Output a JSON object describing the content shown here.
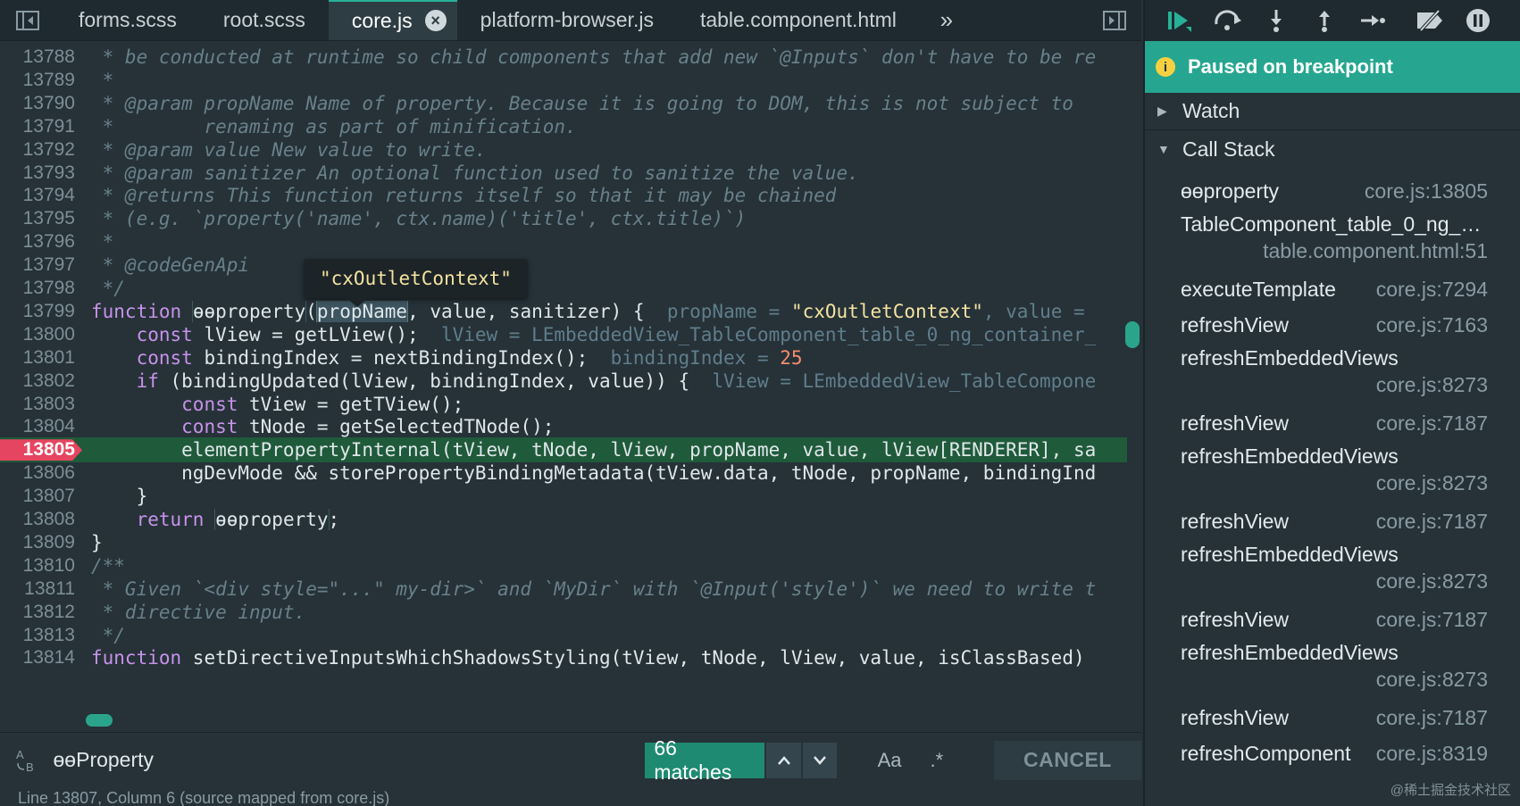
{
  "tabs": [
    "forms.scss",
    "root.scss",
    "core.js",
    "platform-browser.js",
    "table.component.html"
  ],
  "active_tab_index": 2,
  "code_lines": [
    {
      "n": "13788",
      "html": "<span class='cm'> * be conducted at runtime so child components that add new `@Inputs` don't have to be re</span>"
    },
    {
      "n": "13789",
      "html": "<span class='cm'> *</span>"
    },
    {
      "n": "13790",
      "html": "<span class='cm'> * @param propName Name of property. Because it is going to DOM, this is not subject to</span>"
    },
    {
      "n": "13791",
      "html": "<span class='cm'> *        renaming as part of minification.</span>"
    },
    {
      "n": "13792",
      "html": "<span class='cm'> * @param value New value to write.</span>"
    },
    {
      "n": "13793",
      "html": "<span class='cm'> * @param sanitizer An optional function used to sanitize the value.</span>"
    },
    {
      "n": "13794",
      "html": "<span class='cm'> * @returns This function returns itself so that it may be chained</span>"
    },
    {
      "n": "13795",
      "html": "<span class='cm'> * (e.g. `property('name', ctx.name)('title', ctx.title)`)</span>"
    },
    {
      "n": "13796",
      "html": "<span class='cm'> *</span>"
    },
    {
      "n": "13797",
      "html": "<span class='cm'> * @codeGenApi</span>"
    },
    {
      "n": "13798",
      "html": "<span class='cm'> */</span>"
    },
    {
      "n": "13799",
      "html": "<span class='kw'>function</span> <span class='boxed'>ɵɵproperty</span>(<span class='sel'>propName</span>, value, sanitizer) {  <span class='inline-val'>propName = </span><span class='inline-str'>\"cxOutletContext\"</span><span class='inline-val'>, value = </span>"
    },
    {
      "n": "13800",
      "html": "    <span class='kw'>const</span> lView = getLView();  <span class='inline-val'>lView = LEmbeddedView_TableComponent_table_0_ng_container_</span>"
    },
    {
      "n": "13801",
      "html": "    <span class='kw'>const</span> bindingIndex = nextBindingIndex();  <span class='inline-val'>bindingIndex = </span><span class='inline-num'>25</span>"
    },
    {
      "n": "13802",
      "html": "    <span class='kw'>if</span> (bindingUpdated(lView, bindingIndex, value)) {  <span class='inline-val'>lView = LEmbeddedView_TableCompone</span>"
    },
    {
      "n": "13803",
      "html": "        <span class='kw'>const</span> tView = getTView();"
    },
    {
      "n": "13804",
      "html": "        <span class='kw'>const</span> tNode = getSelectedTNode();"
    },
    {
      "n": "13805",
      "html": "        elementPropertyInternal(tView, tNode, lView, propName, value, lView[RENDERER], sa",
      "current": true
    },
    {
      "n": "13806",
      "html": "        ngDevMode &amp;&amp; storePropertyBindingMetadata(tView.data, tNode, propName, bindingInd"
    },
    {
      "n": "13807",
      "html": "    }"
    },
    {
      "n": "13808",
      "html": "    <span class='kw'>return</span> <span class='boxed'>ɵɵproperty</span>;"
    },
    {
      "n": "13809",
      "html": "}"
    },
    {
      "n": "13810",
      "html": "<span class='cm'>/**</span>"
    },
    {
      "n": "13811",
      "html": "<span class='cm'> * Given `&lt;div style=\"...\" my-dir&gt;` and `MyDir` with `@Input('style')` we need to write t</span>"
    },
    {
      "n": "13812",
      "html": "<span class='cm'> * directive input.</span>"
    },
    {
      "n": "13813",
      "html": "<span class='cm'> */</span>"
    },
    {
      "n": "13814",
      "html": "<span class='kw'>function</span> setDirectiveInputsWhichShadowsStyling(tView, tNode, lView, value, isClassBased)"
    }
  ],
  "tooltip": "\"cxOutletContext\"",
  "search": {
    "value": "ɵɵProperty",
    "matches": "66 matches",
    "case_label": "Aa",
    "regex_label": ".*",
    "cancel_label": "CANCEL"
  },
  "status_text": "Line 13807, Column 6    (source mapped from core.js)",
  "debugger": {
    "paused_label": "Paused on breakpoint",
    "watch_label": "Watch",
    "callstack_label": "Call Stack",
    "frames": [
      {
        "name": "ɵɵproperty",
        "loc": "core.js:13805",
        "wrap": false
      },
      {
        "name": "TableComponent_table_0_ng_co...",
        "loc": "table.component.html:51",
        "wrap": true
      },
      {
        "name": "executeTemplate",
        "loc": "core.js:7294",
        "wrap": false
      },
      {
        "name": "refreshView",
        "loc": "core.js:7163",
        "wrap": false
      },
      {
        "name": "refreshEmbeddedViews",
        "loc": "core.js:8273",
        "wrap": true
      },
      {
        "name": "refreshView",
        "loc": "core.js:7187",
        "wrap": false
      },
      {
        "name": "refreshEmbeddedViews",
        "loc": "core.js:8273",
        "wrap": true
      },
      {
        "name": "refreshView",
        "loc": "core.js:7187",
        "wrap": false
      },
      {
        "name": "refreshEmbeddedViews",
        "loc": "core.js:8273",
        "wrap": true
      },
      {
        "name": "refreshView",
        "loc": "core.js:7187",
        "wrap": false
      },
      {
        "name": "refreshEmbeddedViews",
        "loc": "core.js:8273",
        "wrap": true
      },
      {
        "name": "refreshView",
        "loc": "core.js:7187",
        "wrap": false
      },
      {
        "name": "refreshComponent",
        "loc": "core.js:8319",
        "wrap": false
      }
    ]
  },
  "watermark": "@稀土掘金技术社区",
  "colors": {
    "accent": "#26a690",
    "breakpoint": "#e54560",
    "current_line": "#1f5a3a"
  }
}
